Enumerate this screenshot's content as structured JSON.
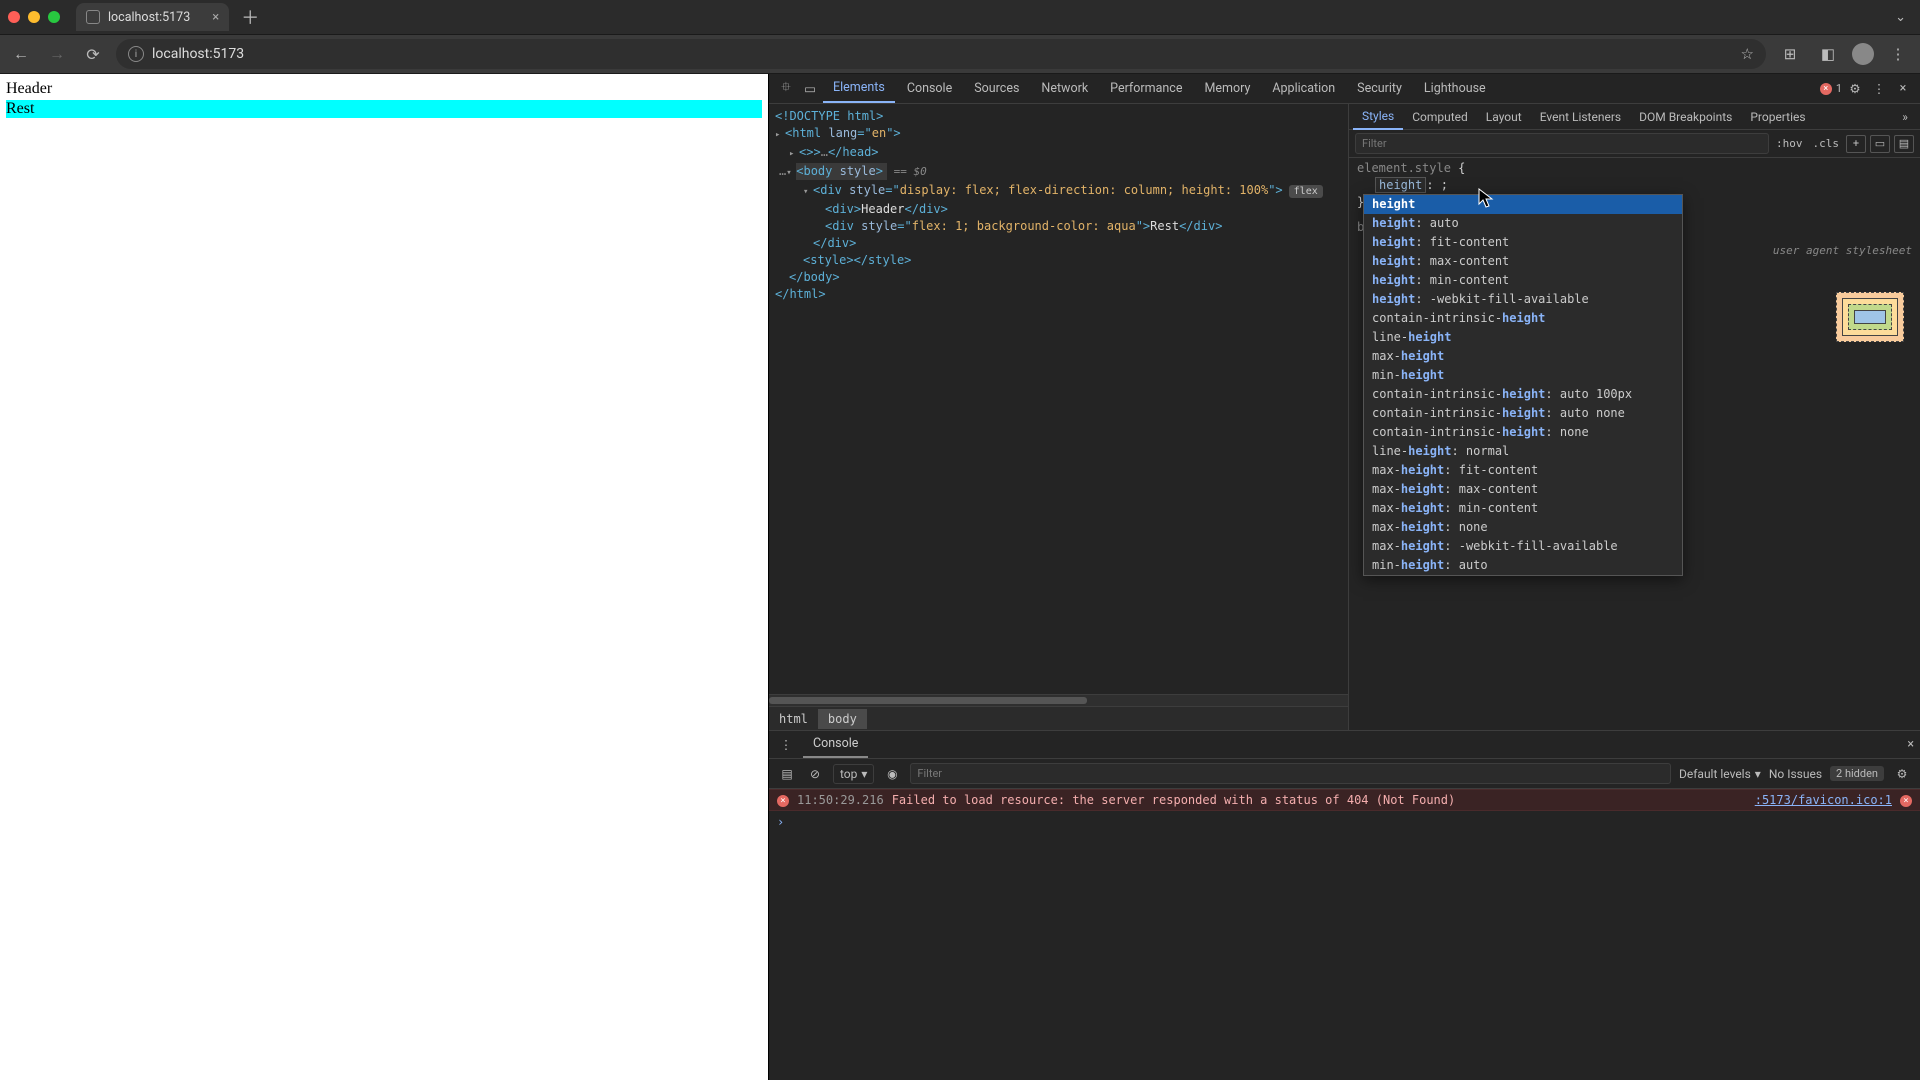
{
  "browser": {
    "tab_title": "localhost:5173",
    "url": "localhost:5173"
  },
  "page": {
    "header_text": "Header",
    "rest_text": "Rest"
  },
  "devtools": {
    "tabs": [
      "Elements",
      "Console",
      "Sources",
      "Network",
      "Performance",
      "Memory",
      "Application",
      "Security",
      "Lighthouse"
    ],
    "active_tab": "Elements",
    "error_count": "1",
    "dom": {
      "l1": "<!DOCTYPE html>",
      "l2a": "<",
      "l2t": "html",
      "l2b": " ",
      "l2an": "lang",
      "l2eq": "=\"",
      "l2av": "en",
      "l2c": "\">",
      "l3a": "<",
      "l3t": "head",
      "l3b": ">",
      "l3d": "…",
      "l3e": "</",
      "l3f": "head",
      "l3g": ">",
      "l4a": "<",
      "l4t": "body",
      "l4b": " ",
      "l4an": "style",
      "l4c": ">",
      "l4eq": " == $0",
      "l5a": "<",
      "l5t": "div",
      "l5b": " ",
      "l5an": "style",
      "l5eq": "=\"",
      "l5av": "display: flex; flex-direction: column; height: 100%",
      "l5c": "\">",
      "l5pill": "flex",
      "l6a": "<",
      "l6t": "div",
      "l6b": ">",
      "l6tx": "Header",
      "l6c": "</",
      "l6d": "div",
      "l6e": ">",
      "l7a": "<",
      "l7t": "div",
      "l7b": " ",
      "l7an": "style",
      "l7eq": "=\"",
      "l7av": "flex: 1; background-color: aqua",
      "l7c": "\">",
      "l7tx": "Rest",
      "l7d": "</",
      "l7e": "div",
      "l7f": ">",
      "l8": "</div>",
      "l9a": "<",
      "l9t": "style",
      "l9b": ">",
      "l9c": "</",
      "l9d": "style",
      "l9e": ">",
      "l10": "</body>",
      "l11": "</html>"
    },
    "breadcrumb": {
      "a": "html",
      "b": "body"
    },
    "styles": {
      "tabs": [
        "Styles",
        "Computed",
        "Layout",
        "Event Listeners",
        "DOM Breakpoints",
        "Properties"
      ],
      "filter_placeholder": "Filter",
      "hov": ":hov",
      "cls": ".cls",
      "rule1_selector": "element.style",
      "rule1_open": " {",
      "rule1_prop": "height",
      "rule1_sep": ": ;",
      "rule1_close": "}",
      "rule2_selector_partial": "bo",
      "uas_label": "user agent stylesheet",
      "autocomplete": [
        "height",
        "height: auto",
        "height: fit-content",
        "height: max-content",
        "height: min-content",
        "height: -webkit-fill-available",
        "contain-intrinsic-height",
        "line-height",
        "max-height",
        "min-height",
        "contain-intrinsic-height: auto 100px",
        "contain-intrinsic-height: auto none",
        "contain-intrinsic-height: none",
        "line-height: normal",
        "max-height: fit-content",
        "max-height: max-content",
        "max-height: min-content",
        "max-height: none",
        "max-height: -webkit-fill-available",
        "min-height: auto"
      ]
    }
  },
  "console": {
    "tab": "Console",
    "context": "top",
    "filter_placeholder": "Filter",
    "levels": "Default levels",
    "issues": "No Issues",
    "hidden": "2 hidden",
    "log": {
      "ts": "11:50:29.216",
      "msg": "Failed to load resource: the server responded with a status of 404 (Not Found)",
      "src": ":5173/favicon.ico:1"
    }
  }
}
